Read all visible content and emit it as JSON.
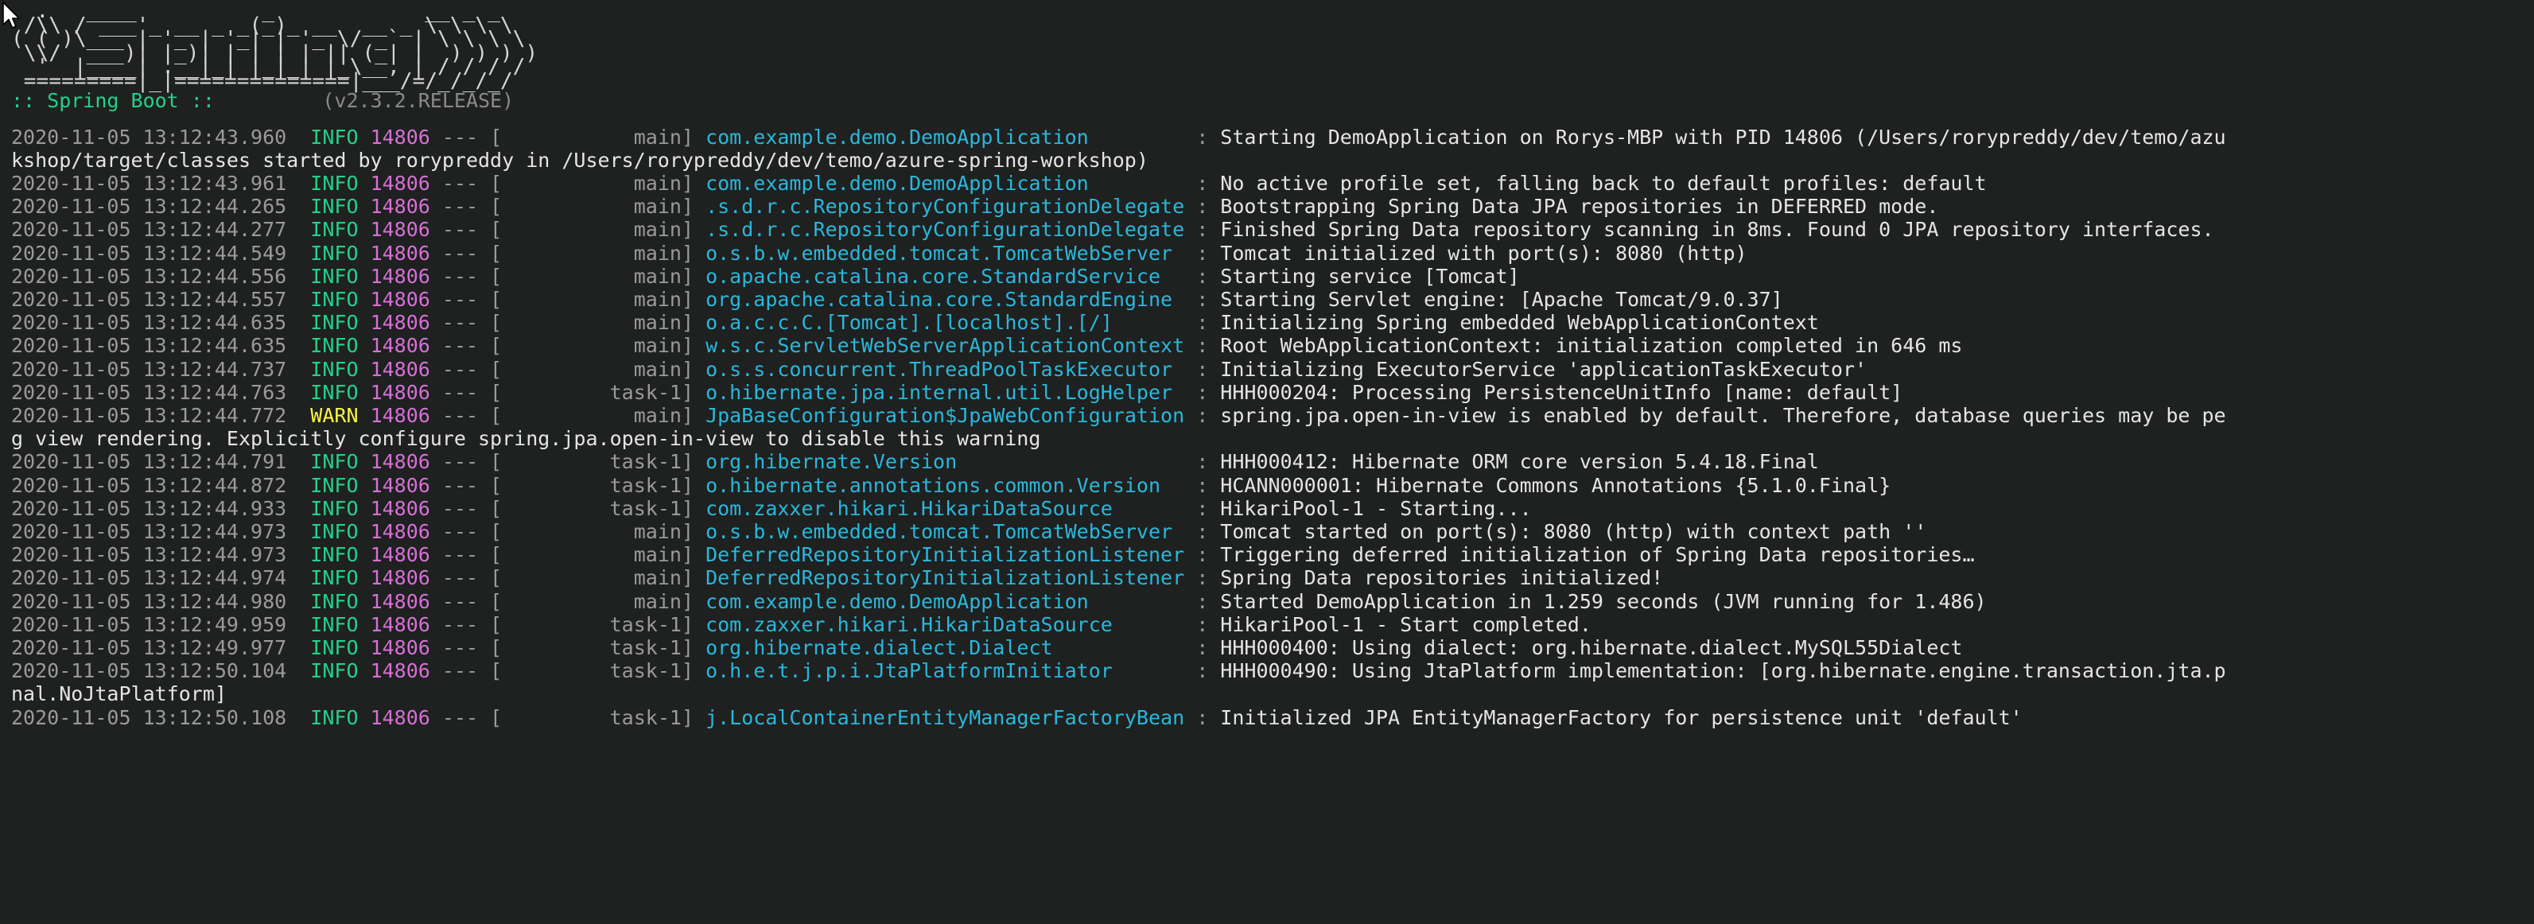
{
  "terminal": {
    "background": "#1f2020",
    "foreground": "#e5e5e5",
    "cursor_icon": "mouse-pointer-icon"
  },
  "banner": {
    "ascii_art": "  .   ____          _            __ _ _\n /\\\\ / ___'_ __ _ _(_)_ __  __ _ \\ \\ \\ \\\n( ( )\\___ | '_ | '_| | '_ \\/ _` | \\ \\ \\ \\\n \\\\/  ___)| |_)| | | | | || (_| |  ) ) ) )\n  '  |____| .__|_| |_|_| |_\\__, | / / / /\n =========|_|==============|___/=/_/_/_/",
    "product": ":: Spring Boot ::",
    "version": "(v2.3.2.RELEASE)",
    "product_color": "#23d18b",
    "version_color": "#8a8a8a"
  },
  "colors": {
    "timestamp": "#9a9a9a",
    "level_info": "#23d18b",
    "level_warn": "#f5f543",
    "pid": "#d670d6",
    "thread": "#9a9a9a",
    "logger": "#29b8db",
    "message": "#e5e5e5"
  },
  "log": {
    "pid": "14806",
    "lines": [
      {
        "type": "entry",
        "timestamp": "2020-11-05 13:12:43.960",
        "level": "INFO",
        "pid": "14806",
        "thread": "main",
        "logger": "com.example.demo.DemoApplication",
        "message": "Starting DemoApplication on Rorys-MBP with PID 14806 (/Users/rorypreddy/dev/temo/azu"
      },
      {
        "type": "wrap",
        "text": "kshop/target/classes started by rorypreddy in /Users/rorypreddy/dev/temo/azure-spring-workshop)"
      },
      {
        "type": "entry",
        "timestamp": "2020-11-05 13:12:43.961",
        "level": "INFO",
        "pid": "14806",
        "thread": "main",
        "logger": "com.example.demo.DemoApplication",
        "message": "No active profile set, falling back to default profiles: default"
      },
      {
        "type": "entry",
        "timestamp": "2020-11-05 13:12:44.265",
        "level": "INFO",
        "pid": "14806",
        "thread": "main",
        "logger": ".s.d.r.c.RepositoryConfigurationDelegate",
        "message": "Bootstrapping Spring Data JPA repositories in DEFERRED mode."
      },
      {
        "type": "entry",
        "timestamp": "2020-11-05 13:12:44.277",
        "level": "INFO",
        "pid": "14806",
        "thread": "main",
        "logger": ".s.d.r.c.RepositoryConfigurationDelegate",
        "message": "Finished Spring Data repository scanning in 8ms. Found 0 JPA repository interfaces."
      },
      {
        "type": "entry",
        "timestamp": "2020-11-05 13:12:44.549",
        "level": "INFO",
        "pid": "14806",
        "thread": "main",
        "logger": "o.s.b.w.embedded.tomcat.TomcatWebServer",
        "message": "Tomcat initialized with port(s): 8080 (http)"
      },
      {
        "type": "entry",
        "timestamp": "2020-11-05 13:12:44.556",
        "level": "INFO",
        "pid": "14806",
        "thread": "main",
        "logger": "o.apache.catalina.core.StandardService",
        "message": "Starting service [Tomcat]"
      },
      {
        "type": "entry",
        "timestamp": "2020-11-05 13:12:44.557",
        "level": "INFO",
        "pid": "14806",
        "thread": "main",
        "logger": "org.apache.catalina.core.StandardEngine",
        "message": "Starting Servlet engine: [Apache Tomcat/9.0.37]"
      },
      {
        "type": "entry",
        "timestamp": "2020-11-05 13:12:44.635",
        "level": "INFO",
        "pid": "14806",
        "thread": "main",
        "logger": "o.a.c.c.C.[Tomcat].[localhost].[/]",
        "message": "Initializing Spring embedded WebApplicationContext"
      },
      {
        "type": "entry",
        "timestamp": "2020-11-05 13:12:44.635",
        "level": "INFO",
        "pid": "14806",
        "thread": "main",
        "logger": "w.s.c.ServletWebServerApplicationContext",
        "message": "Root WebApplicationContext: initialization completed in 646 ms"
      },
      {
        "type": "entry",
        "timestamp": "2020-11-05 13:12:44.737",
        "level": "INFO",
        "pid": "14806",
        "thread": "main",
        "logger": "o.s.s.concurrent.ThreadPoolTaskExecutor",
        "message": "Initializing ExecutorService 'applicationTaskExecutor'"
      },
      {
        "type": "entry",
        "timestamp": "2020-11-05 13:12:44.763",
        "level": "INFO",
        "pid": "14806",
        "thread": "task-1",
        "logger": "o.hibernate.jpa.internal.util.LogHelper",
        "message": "HHH000204: Processing PersistenceUnitInfo [name: default]"
      },
      {
        "type": "entry",
        "timestamp": "2020-11-05 13:12:44.772",
        "level": "WARN",
        "pid": "14806",
        "thread": "main",
        "logger": "JpaBaseConfiguration$JpaWebConfiguration",
        "message": "spring.jpa.open-in-view is enabled by default. Therefore, database queries may be pe"
      },
      {
        "type": "wrap",
        "text": "g view rendering. Explicitly configure spring.jpa.open-in-view to disable this warning"
      },
      {
        "type": "entry",
        "timestamp": "2020-11-05 13:12:44.791",
        "level": "INFO",
        "pid": "14806",
        "thread": "task-1",
        "logger": "org.hibernate.Version",
        "message": "HHH000412: Hibernate ORM core version 5.4.18.Final"
      },
      {
        "type": "entry",
        "timestamp": "2020-11-05 13:12:44.872",
        "level": "INFO",
        "pid": "14806",
        "thread": "task-1",
        "logger": "o.hibernate.annotations.common.Version",
        "message": "HCANN000001: Hibernate Commons Annotations {5.1.0.Final}"
      },
      {
        "type": "entry",
        "timestamp": "2020-11-05 13:12:44.933",
        "level": "INFO",
        "pid": "14806",
        "thread": "task-1",
        "logger": "com.zaxxer.hikari.HikariDataSource",
        "message": "HikariPool-1 - Starting..."
      },
      {
        "type": "entry",
        "timestamp": "2020-11-05 13:12:44.973",
        "level": "INFO",
        "pid": "14806",
        "thread": "main",
        "logger": "o.s.b.w.embedded.tomcat.TomcatWebServer",
        "message": "Tomcat started on port(s): 8080 (http) with context path ''"
      },
      {
        "type": "entry",
        "timestamp": "2020-11-05 13:12:44.973",
        "level": "INFO",
        "pid": "14806",
        "thread": "main",
        "logger": "DeferredRepositoryInitializationListener",
        "message": "Triggering deferred initialization of Spring Data repositories…"
      },
      {
        "type": "entry",
        "timestamp": "2020-11-05 13:12:44.974",
        "level": "INFO",
        "pid": "14806",
        "thread": "main",
        "logger": "DeferredRepositoryInitializationListener",
        "message": "Spring Data repositories initialized!"
      },
      {
        "type": "entry",
        "timestamp": "2020-11-05 13:12:44.980",
        "level": "INFO",
        "pid": "14806",
        "thread": "main",
        "logger": "com.example.demo.DemoApplication",
        "message": "Started DemoApplication in 1.259 seconds (JVM running for 1.486)"
      },
      {
        "type": "entry",
        "timestamp": "2020-11-05 13:12:49.959",
        "level": "INFO",
        "pid": "14806",
        "thread": "task-1",
        "logger": "com.zaxxer.hikari.HikariDataSource",
        "message": "HikariPool-1 - Start completed."
      },
      {
        "type": "entry",
        "timestamp": "2020-11-05 13:12:49.977",
        "level": "INFO",
        "pid": "14806",
        "thread": "task-1",
        "logger": "org.hibernate.dialect.Dialect",
        "message": "HHH000400: Using dialect: org.hibernate.dialect.MySQL55Dialect"
      },
      {
        "type": "entry",
        "timestamp": "2020-11-05 13:12:50.104",
        "level": "INFO",
        "pid": "14806",
        "thread": "task-1",
        "logger": "o.h.e.t.j.p.i.JtaPlatformInitiator",
        "message": "HHH000490: Using JtaPlatform implementation: [org.hibernate.engine.transaction.jta.p"
      },
      {
        "type": "wrap",
        "text": "nal.NoJtaPlatform]"
      },
      {
        "type": "entry",
        "timestamp": "2020-11-05 13:12:50.108",
        "level": "INFO",
        "pid": "14806",
        "thread": "task-1",
        "logger": "j.LocalContainerEntityManagerFactoryBean",
        "message": "Initialized JPA EntityManagerFactory for persistence unit 'default'"
      }
    ]
  }
}
